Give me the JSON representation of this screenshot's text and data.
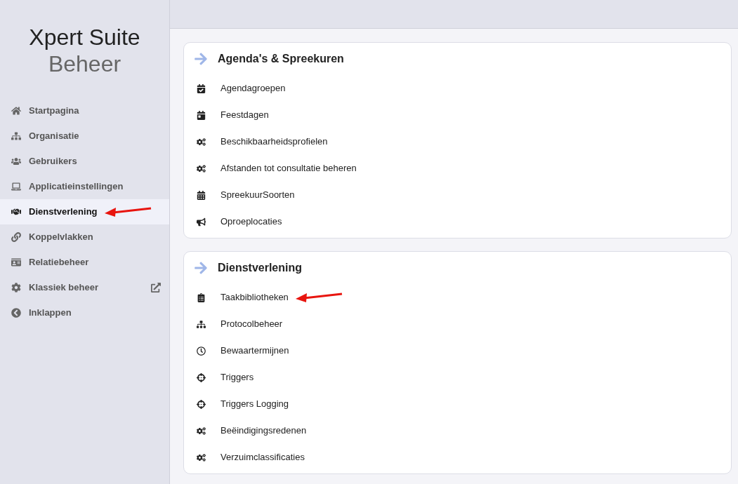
{
  "sidebar": {
    "title": "Xpert Suite",
    "subtitle": "Beheer",
    "items": [
      {
        "label": "Startpagina",
        "kind": "home",
        "selected": false
      },
      {
        "label": "Organisatie",
        "kind": "sitemap",
        "selected": false
      },
      {
        "label": "Gebruikers",
        "kind": "users",
        "selected": false
      },
      {
        "label": "Applicatieinstellingen",
        "kind": "laptop",
        "selected": false
      },
      {
        "label": "Dienstverlening",
        "kind": "handshake",
        "selected": true,
        "marked": true
      },
      {
        "label": "Koppelvlakken",
        "kind": "link",
        "selected": false
      },
      {
        "label": "Relatiebeheer",
        "kind": "idcard",
        "selected": false
      },
      {
        "label": "Klassiek beheer",
        "kind": "cog",
        "selected": false,
        "external": true
      },
      {
        "label": "Inklappen",
        "kind": "collapse",
        "selected": false
      }
    ]
  },
  "sections": [
    {
      "title": "Agenda's & Spreekuren",
      "items": [
        {
          "label": "Agendagroepen",
          "kind": "calendar-edit"
        },
        {
          "label": "Feestdagen",
          "kind": "calendar-star"
        },
        {
          "label": "Beschikbaarheidsprofielen",
          "kind": "cogs"
        },
        {
          "label": "Afstanden tot consultatie beheren",
          "kind": "cogs"
        },
        {
          "label": "SpreekuurSoorten",
          "kind": "calendar"
        },
        {
          "label": "Oproeplocaties",
          "kind": "bullhorn"
        }
      ]
    },
    {
      "title": "Dienstverlening",
      "items": [
        {
          "label": "Taakbibliotheken",
          "kind": "clipboard",
          "marked": true
        },
        {
          "label": "Protocolbeheer",
          "kind": "sitemap"
        },
        {
          "label": "Bewaartermijnen",
          "kind": "clock"
        },
        {
          "label": "Triggers",
          "kind": "crosshairs"
        },
        {
          "label": "Triggers Logging",
          "kind": "crosshairs"
        },
        {
          "label": "Beëindigingsredenen",
          "kind": "cogs"
        },
        {
          "label": "Verzuimclassificaties",
          "kind": "cogs"
        }
      ]
    }
  ]
}
